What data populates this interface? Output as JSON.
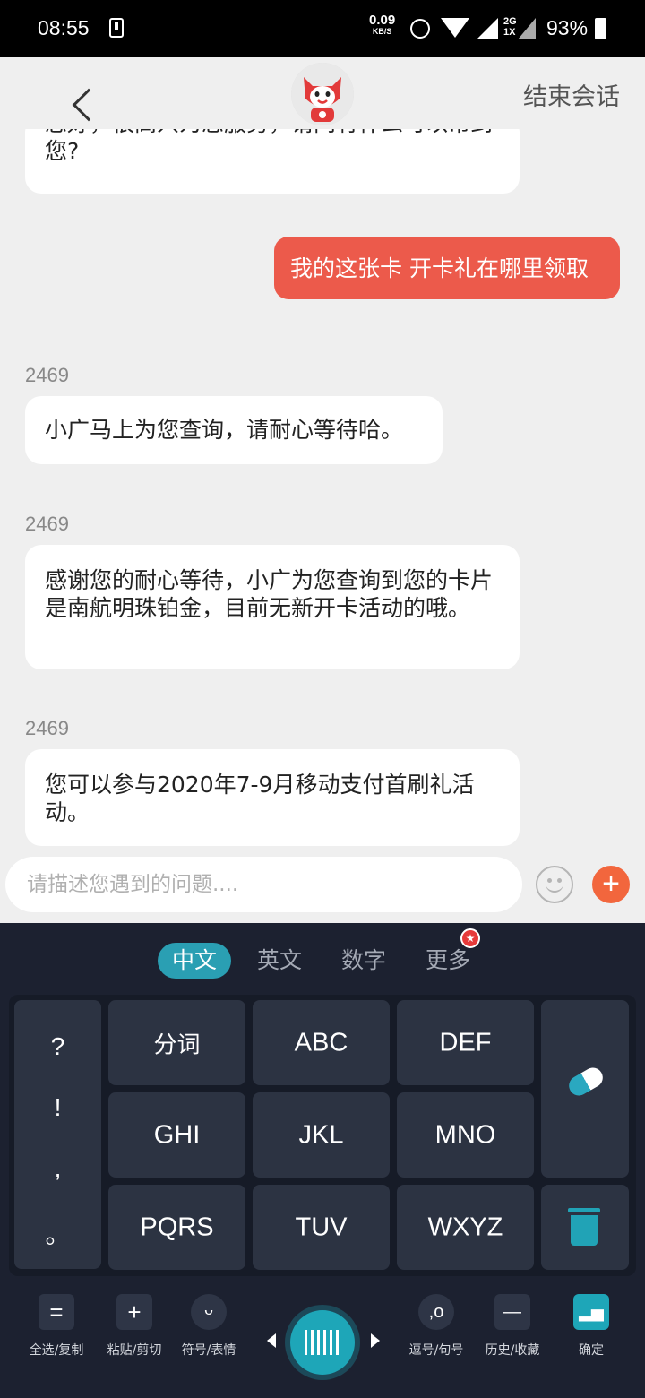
{
  "status_bar": {
    "time": "08:55",
    "net_speed": "0.09",
    "net_speed_unit": "KB/S",
    "network_type": "2G",
    "network_sub": "1X",
    "battery": "93%"
  },
  "header": {
    "end_session_label": "结束会话"
  },
  "messages": {
    "m0": {
      "text": "您好，很高兴为您服务，请问有什么可以帮到您?"
    },
    "m1": {
      "text": "我的这张卡 开卡礼在哪里领取"
    },
    "m2": {
      "sender": "2469",
      "text": "小广马上为您查询，请耐心等待哈。"
    },
    "m3": {
      "sender": "2469",
      "text": "感谢您的耐心等待，小广为您查询到您的卡片是南航明珠铂金，目前无新开卡活动的哦。"
    },
    "m4": {
      "sender": "2469",
      "text": "您可以参与2020年7-9月移动支付首刷礼活动。"
    }
  },
  "input": {
    "placeholder": "请描述您遇到的问题...."
  },
  "keyboard": {
    "tabs": [
      "中文",
      "英文",
      "数字",
      "更多"
    ],
    "punctuation": [
      "?",
      "!",
      ",",
      "。"
    ],
    "keys": [
      "分词",
      "ABC",
      "DEF",
      "GHI",
      "JKL",
      "MNO",
      "PQRS",
      "TUV",
      "WXYZ"
    ],
    "toolbar": {
      "select_copy": "全选/复制",
      "paste_cut": "粘贴/剪切",
      "symbol_emoji": "符号/表情",
      "comma_period": "逗号/句号",
      "history_fav": "历史/收藏",
      "confirm": "确定"
    }
  },
  "colors": {
    "user_bubble": "#ec5a4b",
    "accent": "#1ea6b8",
    "plus_button": "#f2663d",
    "keyboard_bg": "#1c2130"
  }
}
